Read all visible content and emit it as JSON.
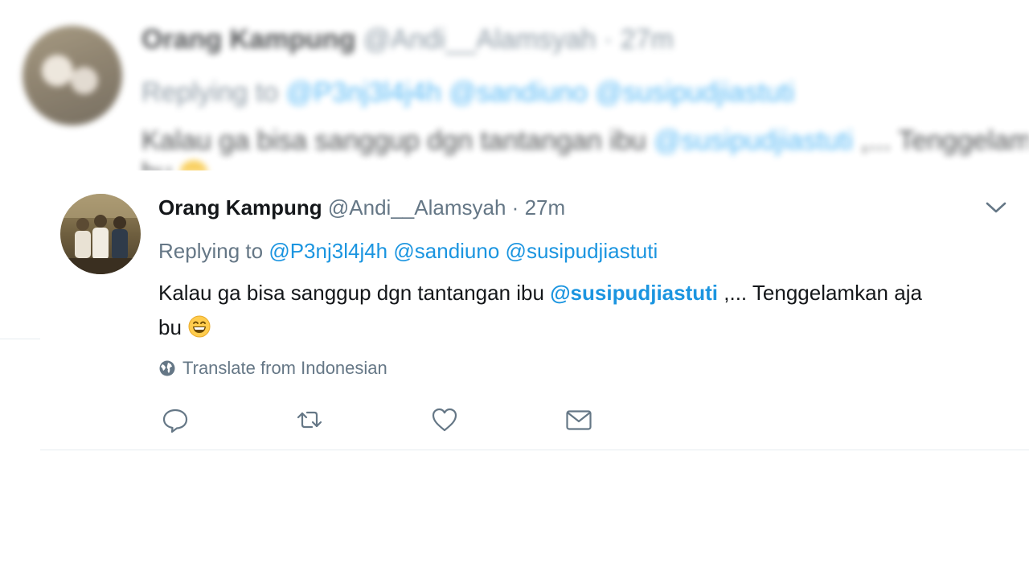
{
  "background_tweet": {
    "display_name": "Orang Kampung",
    "handle": "@Andi__Alamsyah",
    "separator": "·",
    "timestamp": "27m",
    "replying_to_label": "Replying to",
    "mentions": [
      "@P3nj3l4j4h",
      "@sandiuno",
      "@susipudjiastuti"
    ],
    "text_before": "Kalau ga bisa sanggup dgn tantangan ibu",
    "text_mention": "@susipudjiastuti",
    "text_after": ",... Tenggelamkan aja",
    "text_line2": "bu"
  },
  "tweet": {
    "display_name": "Orang Kampung",
    "handle": "@Andi__Alamsyah",
    "separator": "·",
    "timestamp": "27m",
    "replying_to_label": "Replying to",
    "mentions": [
      "@P3nj3l4j4h",
      "@sandiuno",
      "@susipudjiastuti"
    ],
    "text_before": "Kalau ga bisa sanggup dgn tantangan ibu",
    "text_mention": "@susipudjiastuti",
    "text_after": ",... Tenggelamkan aja",
    "text_line2": "bu",
    "emoji": "grinning-face-emoji",
    "translate_label": "Translate from Indonesian"
  },
  "icons": {
    "menu": "chevron-down-icon",
    "translate": "globe-icon",
    "reply": "reply-icon",
    "retweet": "retweet-icon",
    "like": "heart-icon",
    "dm": "envelope-icon"
  },
  "colors": {
    "link": "#1b95e0",
    "muted": "#657786",
    "text": "#14171a",
    "divider": "#e6ecf0"
  }
}
